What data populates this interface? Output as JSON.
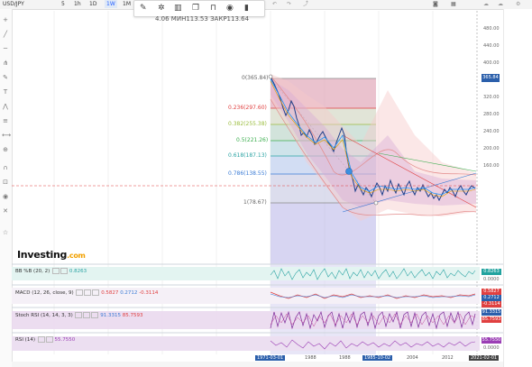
{
  "toolbar": {
    "symbol": "USD/JPY",
    "intervals": [
      "5",
      "1h",
      "1D",
      "1W",
      "1M"
    ],
    "active_interval": "1M"
  },
  "ohlc_legend": "4.06 МИН113.53 ЗАКР113.64",
  "price_axis": {
    "ticks": [
      "480.00",
      "440.00",
      "400.00",
      "360.00",
      "320.00",
      "280.00",
      "240.00",
      "200.00",
      "160.00"
    ],
    "current_price": "365.84"
  },
  "fib_levels": [
    {
      "label": "0(365.84)",
      "color": "#666666"
    },
    {
      "label": "0.236(297.60)",
      "color": "#e04040"
    },
    {
      "label": "0.382(255.38)",
      "color": "#9bbd3e"
    },
    {
      "label": "0.5(221.26)",
      "color": "#3cae4f"
    },
    {
      "label": "0.618(187.13)",
      "color": "#2aa3a3"
    },
    {
      "label": "0.786(138.55)",
      "color": "#3a7bd5"
    },
    {
      "label": "1(78.67)",
      "color": "#666666"
    }
  ],
  "brand": {
    "name": "Investing",
    "suffix": ".com"
  },
  "panes": [
    {
      "id": "bbb",
      "legend": "BB %B (20, 2)",
      "values": [
        "0.8263"
      ],
      "value_colors": [
        "#2aa3a3"
      ],
      "tags": [
        {
          "text": "0.8263",
          "color": "#22a39f"
        }
      ],
      "labels": [
        "0.0000"
      ]
    },
    {
      "id": "macd",
      "legend": "MACD (12, 26, close, 9)",
      "values": [
        "0.5827",
        "0.2712",
        "-0.3114"
      ],
      "value_colors": [
        "#e04040",
        "#3a7bd5",
        "#e04040"
      ],
      "tags": [
        {
          "text": "0.5827",
          "color": "#e04040"
        },
        {
          "text": "0.2712",
          "color": "#2b5fab"
        },
        {
          "text": "-0.3114",
          "color": "#e04040"
        }
      ],
      "labels": []
    },
    {
      "id": "stoch",
      "legend": "Stoch RSI (14, 14, 3, 3)",
      "values": [
        "91.3315",
        "85.7593"
      ],
      "value_colors": [
        "#3a7bd5",
        "#e04040"
      ],
      "tags": [
        {
          "text": "91.3315",
          "color": "#2b5fab"
        },
        {
          "text": "85.7593",
          "color": "#e04040"
        }
      ],
      "labels": []
    },
    {
      "id": "rsi",
      "legend": "RSI (14)",
      "values": [
        "55.7550"
      ],
      "value_colors": [
        "#9b3fb5"
      ],
      "tags": [
        {
          "text": "55.7550",
          "color": "#9b3fb5"
        }
      ],
      "labels": [
        "0.0000"
      ]
    }
  ],
  "time_axis": {
    "start": "1971-03-01",
    "labels": [
      "1988",
      "1988",
      "1985-10-02",
      "2004",
      "2012"
    ],
    "end": "2021-02-01"
  },
  "colors": {
    "up": "#2196f3",
    "accent": "#2b5fab",
    "fib_zone": "#b7b3e8"
  }
}
